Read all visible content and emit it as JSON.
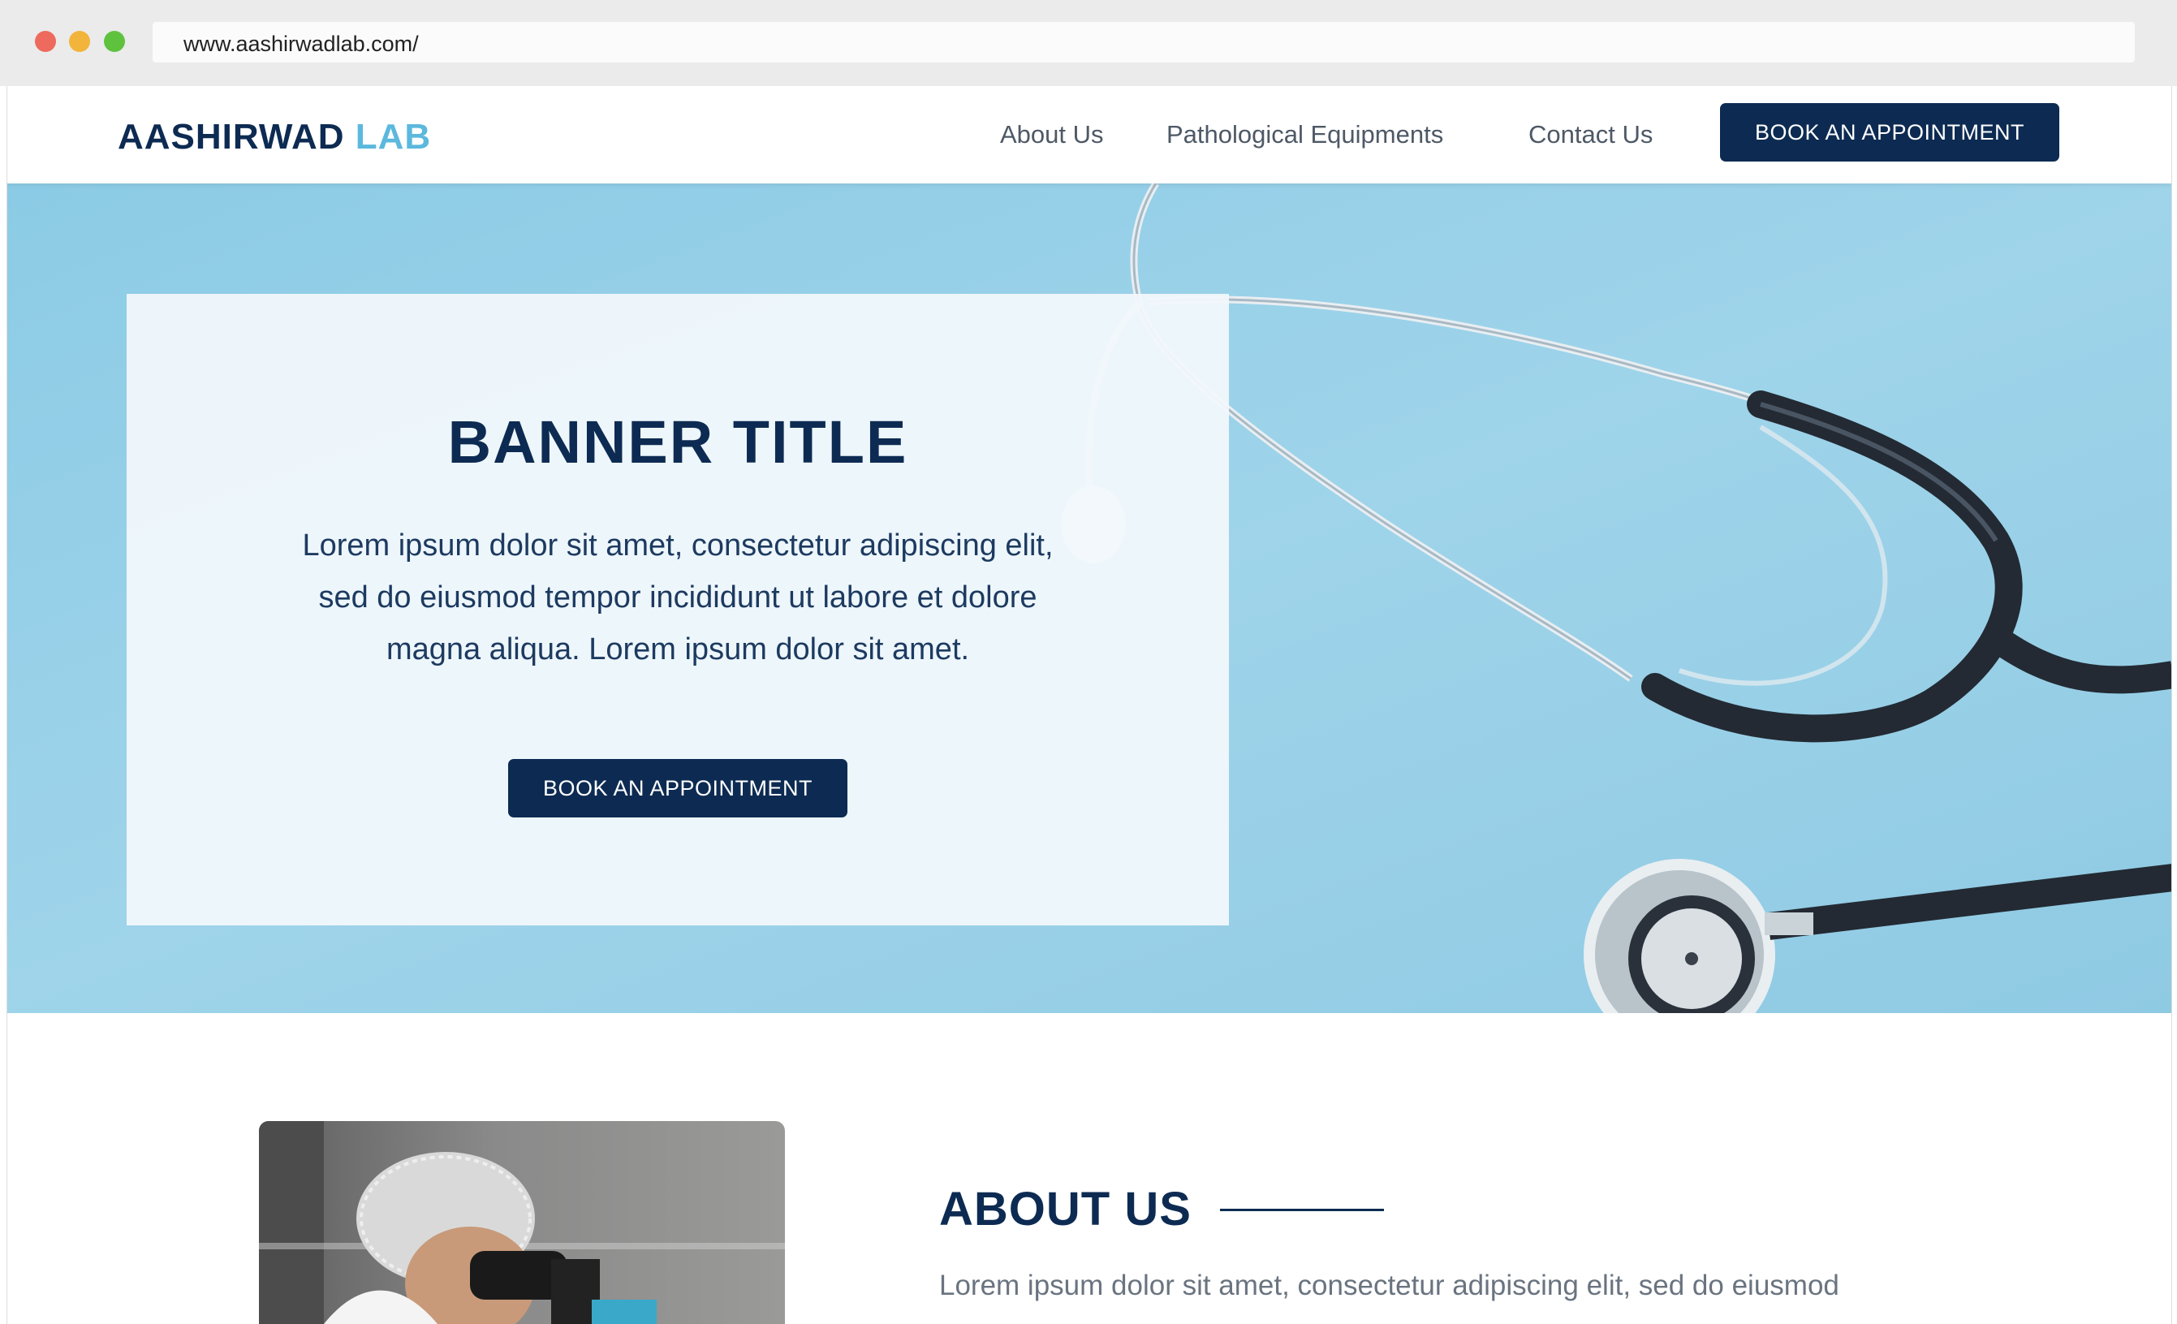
{
  "browser": {
    "url": "www.aashirwadlab.com/"
  },
  "nav": {
    "logo_part1": "AASHIRWAD",
    "logo_part2": "LAB",
    "links": [
      "About Us",
      "Pathological Equipments",
      "Contact Us"
    ],
    "cta_label": "BOOK AN APPOINTMENT"
  },
  "hero": {
    "title": "BANNER TITLE",
    "text": "Lorem ipsum dolor sit amet, consectetur adipiscing elit, sed do eiusmod tempor incididunt ut labore et dolore magna aliqua. Lorem ipsum dolor sit amet.",
    "cta_label": "BOOK AN APPOINTMENT"
  },
  "about": {
    "title": "ABOUT US",
    "text": "Lorem ipsum dolor sit amet, consectetur adipiscing elit, sed do eiusmod"
  },
  "colors": {
    "primary": "#0d2b52",
    "accent": "#5cb8dd",
    "hero_bg": "#9fd4ea",
    "nav_text": "#4e5966"
  }
}
